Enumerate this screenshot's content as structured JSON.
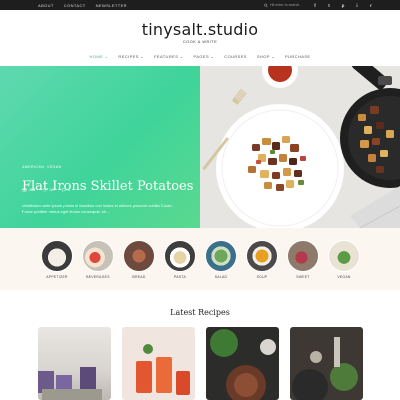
{
  "topbar": {
    "nav": [
      "ABOUT",
      "CONTACT",
      "NEWSLETTER"
    ],
    "search_placeholder": "Hit enter to search",
    "social": [
      {
        "icon": "facebook-icon",
        "glyph": "f"
      },
      {
        "icon": "twitter-icon",
        "glyph": "t"
      },
      {
        "icon": "pinterest-icon",
        "glyph": "p"
      },
      {
        "icon": "instagram-icon",
        "glyph": "i"
      },
      {
        "icon": "rss-icon",
        "glyph": "r"
      }
    ]
  },
  "brand": {
    "logo": "tinysalt.studio",
    "tagline": "COOK & WRITE"
  },
  "mainnav": {
    "items": [
      "HOME ⌄",
      "RECIPES ⌄",
      "FEATURES ⌄",
      "PAGES ⌄",
      "COURSES",
      "SHOP ⌄",
      "PURCHASE"
    ],
    "active_index": 0,
    "active_color": "#4caf7d"
  },
  "hero": {
    "kicker": "AMERICAN, VEGAN",
    "title": "Flat Irons Skillet Potatoes",
    "excerpt": "Vestibulum ante ipsum primis in faucibus orci luctus et ultrices posuere cubilia Curae; Fusce porttitor metus eget lectus consequat, sit ...",
    "stats": {
      "views": "364",
      "likes": "28",
      "comments": "0"
    },
    "gradient_color": "#3fd49a"
  },
  "categories": [
    {
      "label": "APPETIZER"
    },
    {
      "label": "BEVERAGES"
    },
    {
      "label": "BREAD"
    },
    {
      "label": "PASTA"
    },
    {
      "label": "SALAD"
    },
    {
      "label": "SOUP"
    },
    {
      "label": "SWEET"
    },
    {
      "label": "VEGAN"
    }
  ],
  "latest": {
    "heading": "Latest Recipes"
  }
}
